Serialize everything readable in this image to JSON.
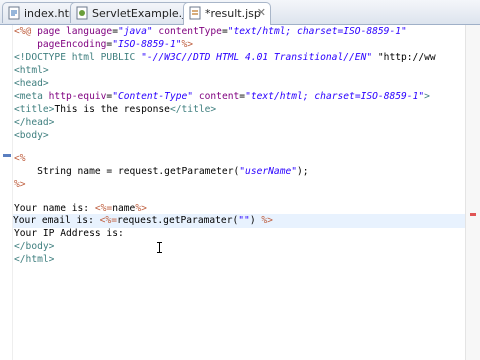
{
  "tabs": [
    {
      "label": "index.html",
      "icon": "html-file-icon",
      "active": false
    },
    {
      "label": "ServletExample.java",
      "icon": "java-file-icon",
      "active": false
    },
    {
      "label": "*result.jsp",
      "icon": "jsp-file-icon",
      "active": true
    }
  ],
  "colors": {
    "tag": "#3f7f7f",
    "attribute": "#7f007f",
    "string": "#2a00ff",
    "jsp_delimiter": "#bf5f3f",
    "current_line": "#e8f2fe"
  },
  "code": {
    "l1": {
      "a": "<%@",
      "b": " page ",
      "c": "language",
      "d": "=",
      "e": "\"java\"",
      "f": " contentType",
      "g": "=",
      "h": "\"text/html; charset=ISO-8859-1\""
    },
    "l2": {
      "a": "    pageEncoding",
      "b": "=",
      "c": "\"ISO-8859-1\"",
      "d": "%>"
    },
    "l3": {
      "a": "<!DOCTYPE html PUBLIC ",
      "b": "\"-//W3C//DTD HTML 4.01 Transitional//EN\"",
      "c": " \"http://ww"
    },
    "l4": {
      "a": "<html>"
    },
    "l5": {
      "a": "<head>"
    },
    "l6": {
      "a": "<meta ",
      "b": "http-equiv",
      "c": "=",
      "d": "\"Content-Type\"",
      "e": " content",
      "f": "=",
      "g": "\"text/html; charset=ISO-8859-1\"",
      "h": ">"
    },
    "l7": {
      "a": "<title>",
      "b": "This is the response",
      "c": "</title>"
    },
    "l8": {
      "a": "</head>"
    },
    "l9": {
      "a": "<body>"
    },
    "l10": {
      "a": "<%"
    },
    "l11": {
      "a": "    String name = request.getParameter(",
      "b": "\"userName\"",
      "c": ");"
    },
    "l12": {
      "a": "%>"
    },
    "l13": {
      "a": "Your name is: ",
      "b": "<%=",
      "c": "name",
      "d": "%>"
    },
    "l14": {
      "a": "Your email is: ",
      "b": "<%=",
      "c": "request.getParamater(",
      "d": "\"\"",
      "e": ") ",
      "f": "%>"
    },
    "l15": {
      "a": "Your IP Address is:"
    },
    "l16": {
      "a": "</body>"
    },
    "l17": {
      "a": "</html>"
    }
  }
}
